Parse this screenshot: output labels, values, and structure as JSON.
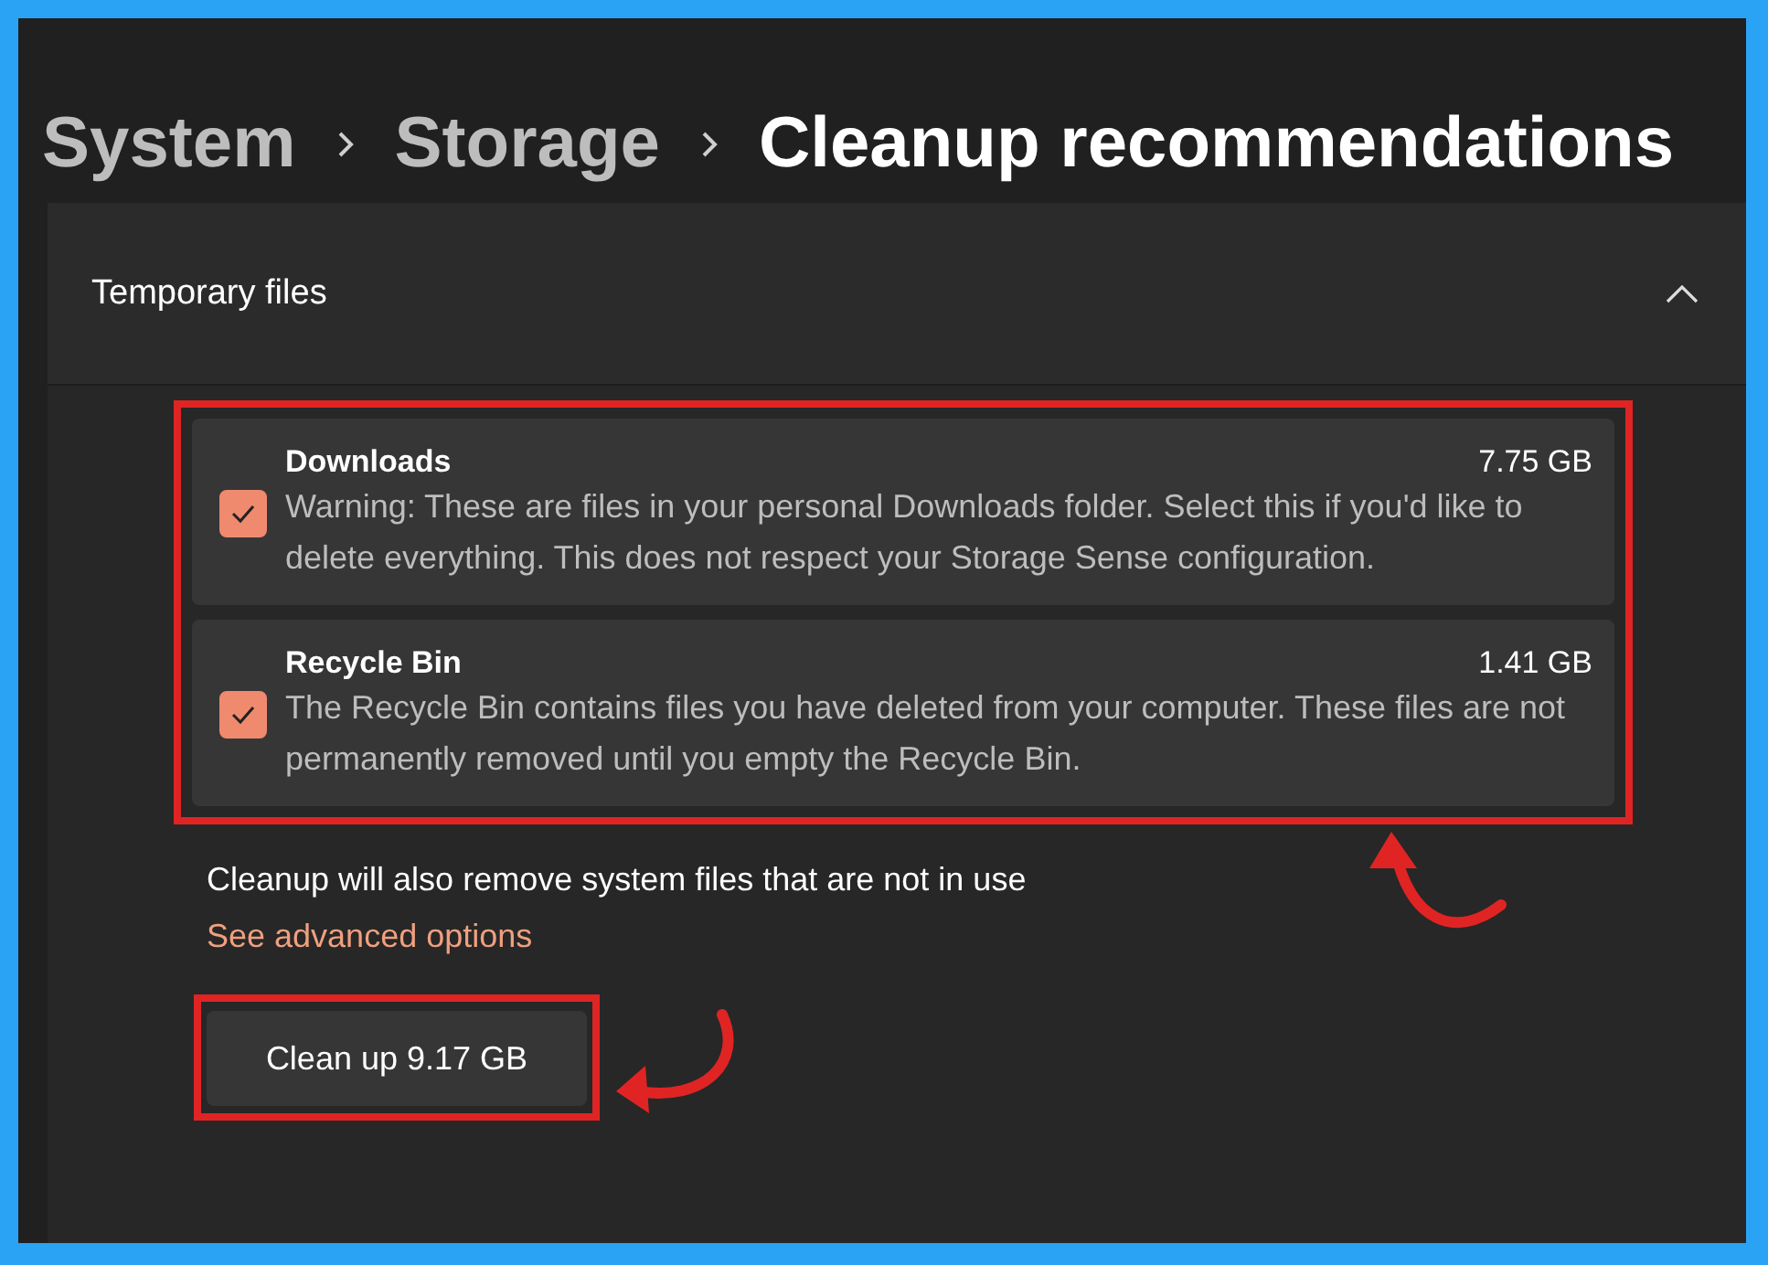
{
  "breadcrumb": [
    {
      "label": "System",
      "current": false
    },
    {
      "label": "Storage",
      "current": false
    },
    {
      "label": "Cleanup recommendations",
      "current": true
    }
  ],
  "section": {
    "title": "Temporary files",
    "expanded": true,
    "items": [
      {
        "name": "Downloads",
        "size": "7.75 GB",
        "checked": true,
        "description": "Warning: These are files in your personal Downloads folder. Select this if you'd like to delete everything. This does not respect your Storage Sense configuration."
      },
      {
        "name": "Recycle Bin",
        "size": "1.41 GB",
        "checked": true,
        "description": "The Recycle Bin contains files you have deleted from your computer. These files are not permanently removed until you empty the Recycle Bin."
      }
    ],
    "note": "Cleanup will also remove system files that are not in use",
    "link": "See advanced options",
    "button": "Clean up 9.17 GB"
  }
}
